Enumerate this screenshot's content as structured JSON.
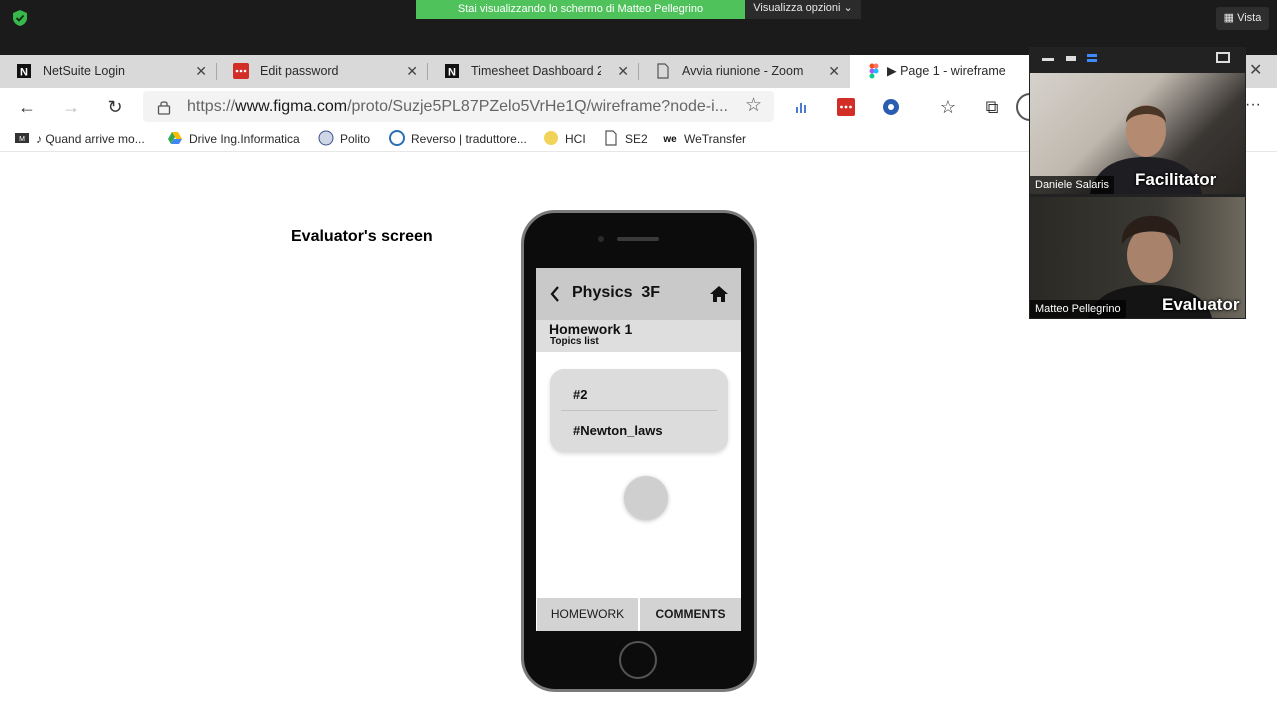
{
  "zoom": {
    "share_banner": "Stai visualizzando lo schermo di Matteo Pellegrino",
    "view_options": "Visualizza opzioni ⌄",
    "vista": "Vista"
  },
  "tabs": [
    {
      "title": "NetSuite Login",
      "icon": "notion-icon"
    },
    {
      "title": "Edit password",
      "icon": "lastpass-icon"
    },
    {
      "title": "Timesheet Dashboard 2.0 ·",
      "icon": "notion-icon"
    },
    {
      "title": "Avvia riunione - Zoom",
      "icon": "page-icon"
    },
    {
      "title": "▶ Page 1 - wireframe",
      "icon": "figma-icon",
      "active": true
    }
  ],
  "address_bar": {
    "url_prefix": "https://",
    "url_domain": "www.figma.com",
    "url_rest": "/proto/Suzje5PL87PZelo5VrHe1Q/wireframe?node-i..."
  },
  "bookmarks": [
    {
      "label": "♪ Quand arrive mo...",
      "icon": "music-icon"
    },
    {
      "label": "Drive Ing.Informatica",
      "icon": "drive-icon"
    },
    {
      "label": "Polito",
      "icon": "polito-icon"
    },
    {
      "label": "Reverso | traduttore...",
      "icon": "reverso-icon"
    },
    {
      "label": "HCI",
      "icon": "hci-icon"
    },
    {
      "label": "SE2",
      "icon": "page-icon"
    },
    {
      "label": "WeTransfer",
      "icon": "wetransfer-icon"
    }
  ],
  "evaluator_label": "Evaluator's screen",
  "app": {
    "course_title": "Physics  3F",
    "homework_title": "Homework 1",
    "homework_subtitle": "Topics list",
    "topics": [
      "#2",
      "#Newton_laws"
    ],
    "bottom_tabs": [
      "HOMEWORK",
      "COMMENTS"
    ]
  },
  "participants": [
    {
      "name": "Daniele Salaris",
      "role": "Facilitator"
    },
    {
      "name": "Matteo Pellegrino",
      "role": "Evaluator"
    }
  ],
  "colors": {
    "share_banner": "#4fc25c",
    "zoom_bar": "#1b1b1b",
    "app_header": "#c9c9c9"
  }
}
